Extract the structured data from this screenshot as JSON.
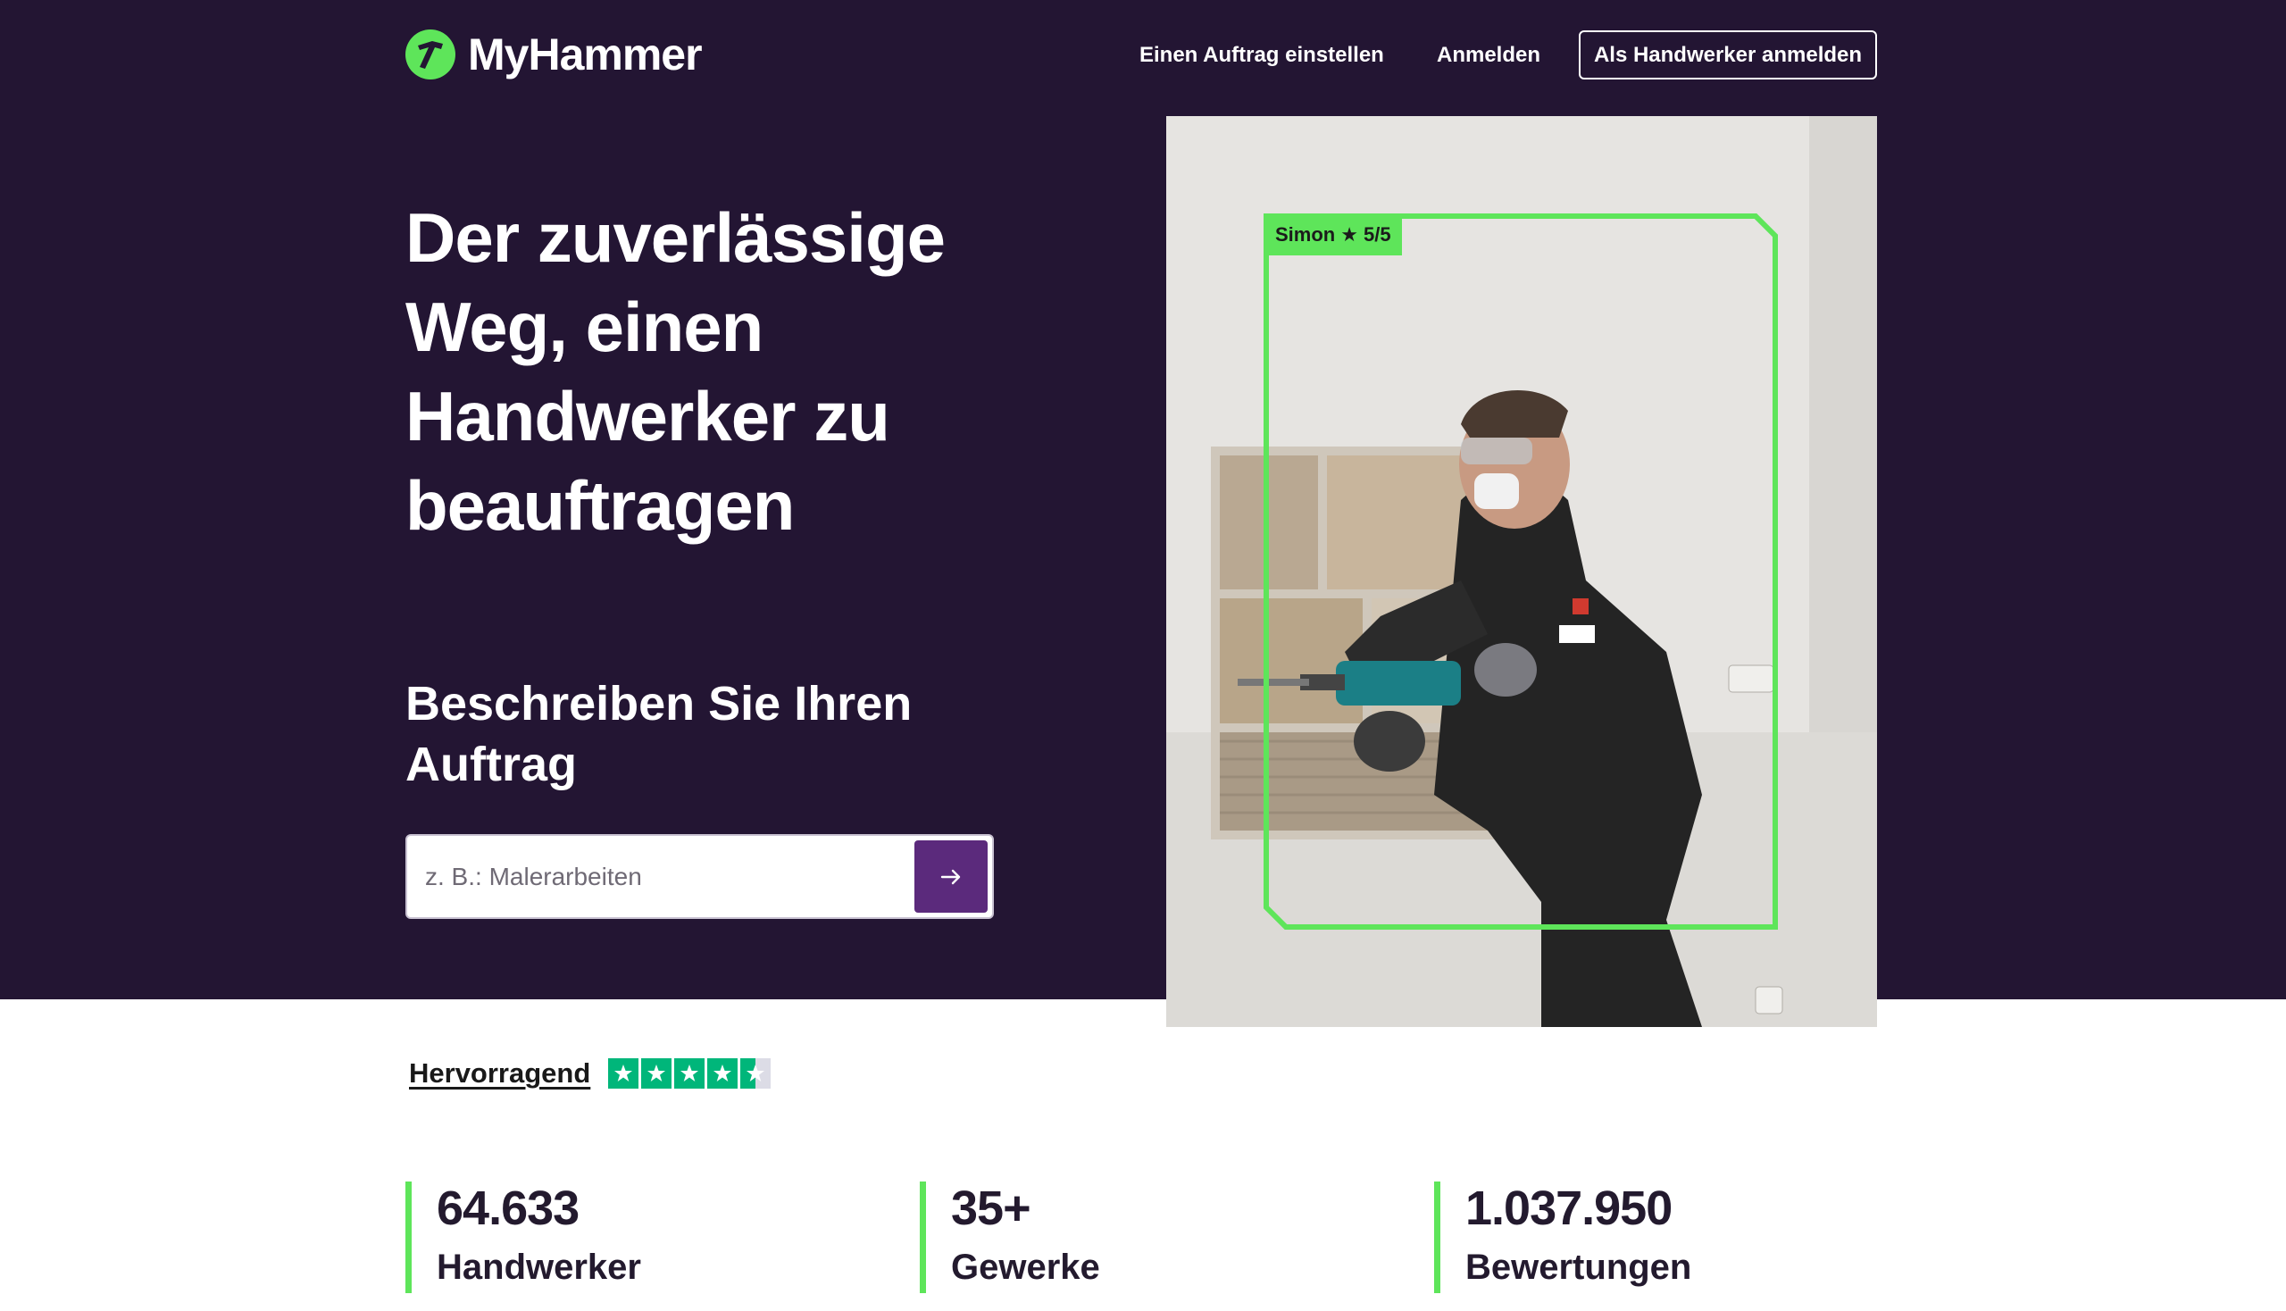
{
  "header": {
    "logo_text": "MyHammer",
    "nav": {
      "post_job": "Einen Auftrag einstellen",
      "login": "Anmelden",
      "pro_signup": "Als Handwerker anmelden"
    }
  },
  "hero": {
    "headline": "Der zuverlässige Weg, einen Handwerker zu beauftragen",
    "subheadline": "Beschreiben Sie Ihren Auftrag",
    "search": {
      "placeholder": "z. B.: Malerarbeiten",
      "value": ""
    },
    "photo": {
      "badge_name": "Simon",
      "badge_rating": "5/5"
    }
  },
  "trust": {
    "label": "Hervorragend",
    "stars": 4.5
  },
  "stats": [
    {
      "number": "64.633",
      "label": "Handwerker"
    },
    {
      "number": "35+",
      "label": "Gewerke"
    },
    {
      "number": "1.037.950",
      "label": "Bewertungen"
    }
  ],
  "colors": {
    "hero_bg": "#231533",
    "accent_green": "#5ee55a",
    "button_purple": "#5b2a7c",
    "trustpilot_green": "#00b67a"
  }
}
